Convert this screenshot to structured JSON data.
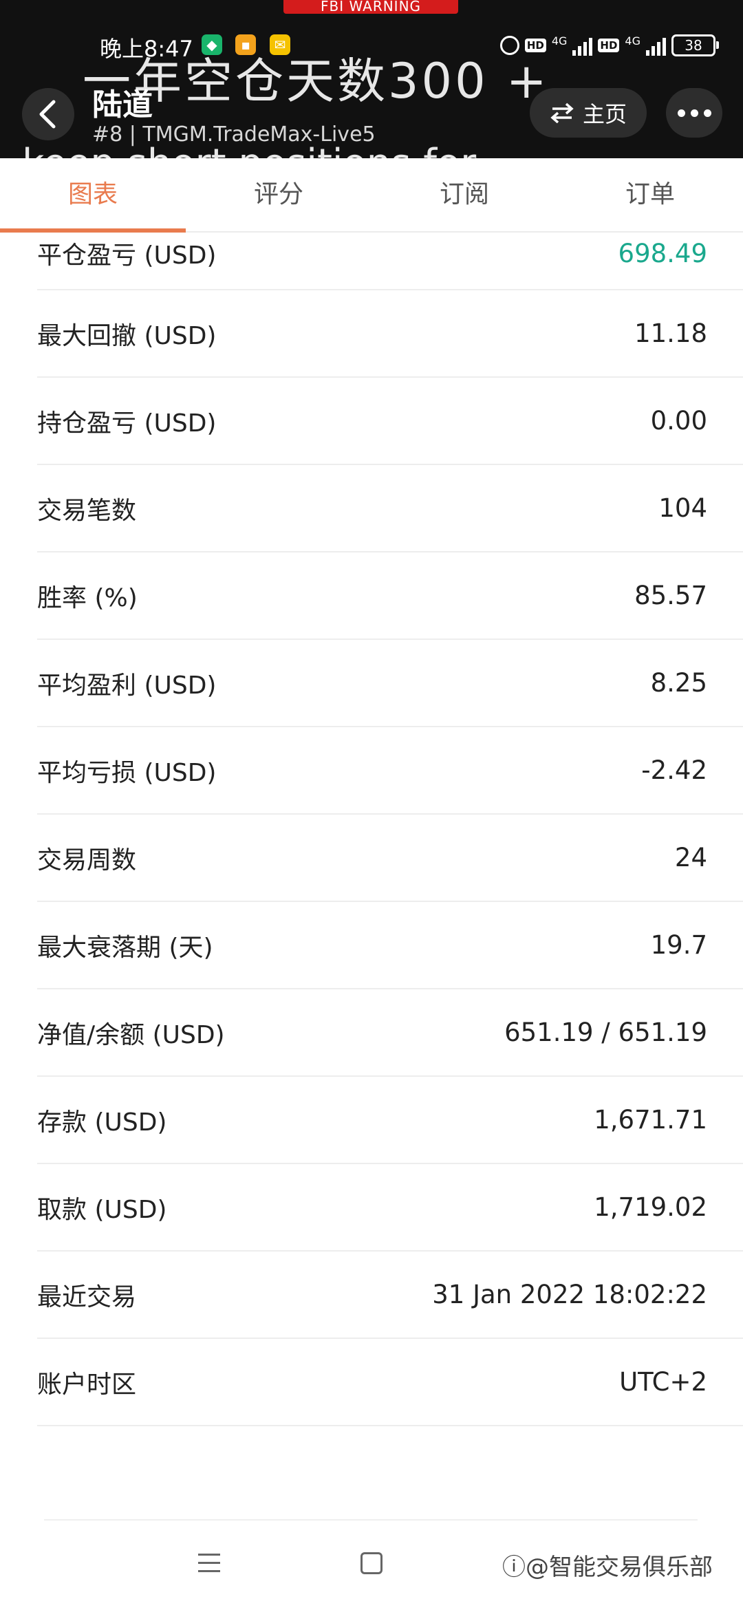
{
  "status_bar": {
    "warning_tag": "FBI WARNING",
    "time": "晚上8:47",
    "network1": "4G",
    "network2": "4G",
    "hd1": "HD",
    "hd2": "HD",
    "battery": "38"
  },
  "overlay": {
    "line1": "一年空仓天数300 +",
    "line2": "keep short positions for"
  },
  "header": {
    "title": "陆道",
    "subtitle": "#8 | TMGM.TradeMax-Live5",
    "home_label": "主页"
  },
  "tabs": [
    {
      "label": "图表"
    },
    {
      "label": "评分"
    },
    {
      "label": "订阅"
    },
    {
      "label": "订单"
    }
  ],
  "stats": [
    {
      "label": "平仓盈亏 (USD)",
      "value": "698.49"
    },
    {
      "label": "最大回撤 (USD)",
      "value": "11.18"
    },
    {
      "label": "持仓盈亏 (USD)",
      "value": "0.00"
    },
    {
      "label": "交易笔数",
      "value": "104"
    },
    {
      "label": "胜率 (%)",
      "value": "85.57"
    },
    {
      "label": "平均盈利 (USD)",
      "value": "8.25"
    },
    {
      "label": "平均亏损 (USD)",
      "value": "-2.42"
    },
    {
      "label": "交易周数",
      "value": "24"
    },
    {
      "label": "最大衰落期 (天)",
      "value": "19.7"
    },
    {
      "label": "净值/余额 (USD)",
      "value": "651.19 / 651.19"
    },
    {
      "label": "存款 (USD)",
      "value": "1,671.71"
    },
    {
      "label": "取款 (USD)",
      "value": "1,719.02"
    },
    {
      "label": "最近交易",
      "value": "31 Jan 2022 18:02:22"
    },
    {
      "label": "账户时区",
      "value": "UTC+2"
    }
  ],
  "watermark": "智能交易俱乐部",
  "colors": {
    "accent": "#e97b4e",
    "profit_green": "#1aa88d",
    "header_bg": "#111111"
  }
}
